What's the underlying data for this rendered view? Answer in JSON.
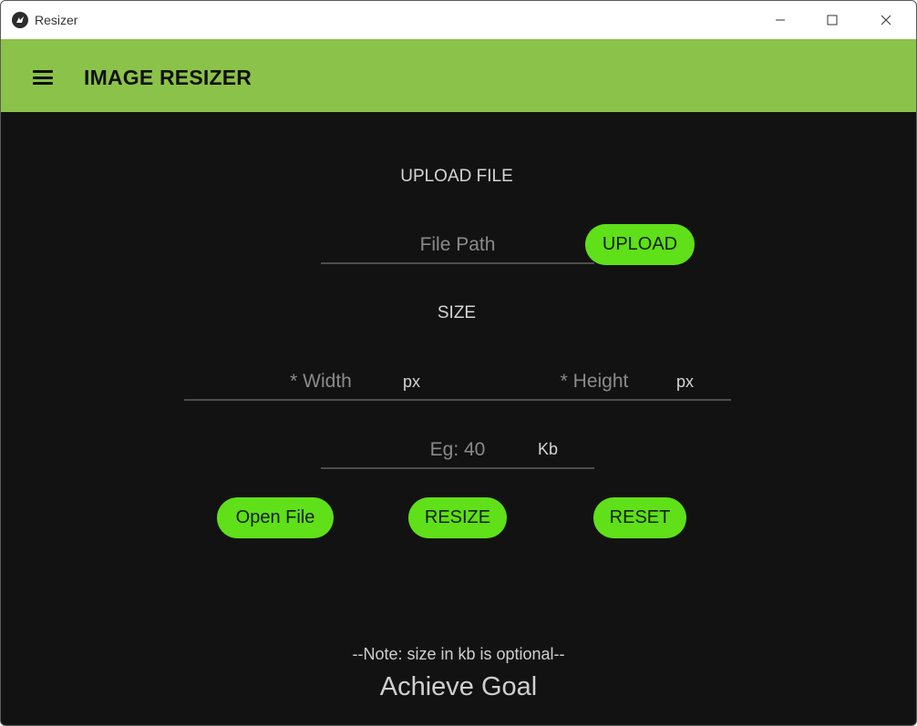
{
  "window": {
    "title": "Resizer"
  },
  "toolbar": {
    "title": "IMAGE RESIZER",
    "color": "#8bc34a"
  },
  "upload": {
    "section_label": "UPLOAD FILE",
    "file_path_placeholder": "File Path",
    "upload_button": "UPLOAD"
  },
  "size": {
    "section_label": "SIZE",
    "width_placeholder": "* Width",
    "width_unit": "px",
    "height_placeholder": "* Height",
    "height_unit": "px",
    "kb_placeholder": "Eg: 40",
    "kb_unit": "Kb"
  },
  "actions": {
    "open_file": "Open File",
    "resize": "RESIZE",
    "reset": "RESET",
    "button_color": "#5fe018"
  },
  "footer": {
    "note": "--Note: size in kb is optional--",
    "goal": "Achieve Goal"
  },
  "icons": [
    "kivy-app-icon",
    "minimize-icon",
    "maximize-icon",
    "close-icon",
    "menu-icon"
  ]
}
